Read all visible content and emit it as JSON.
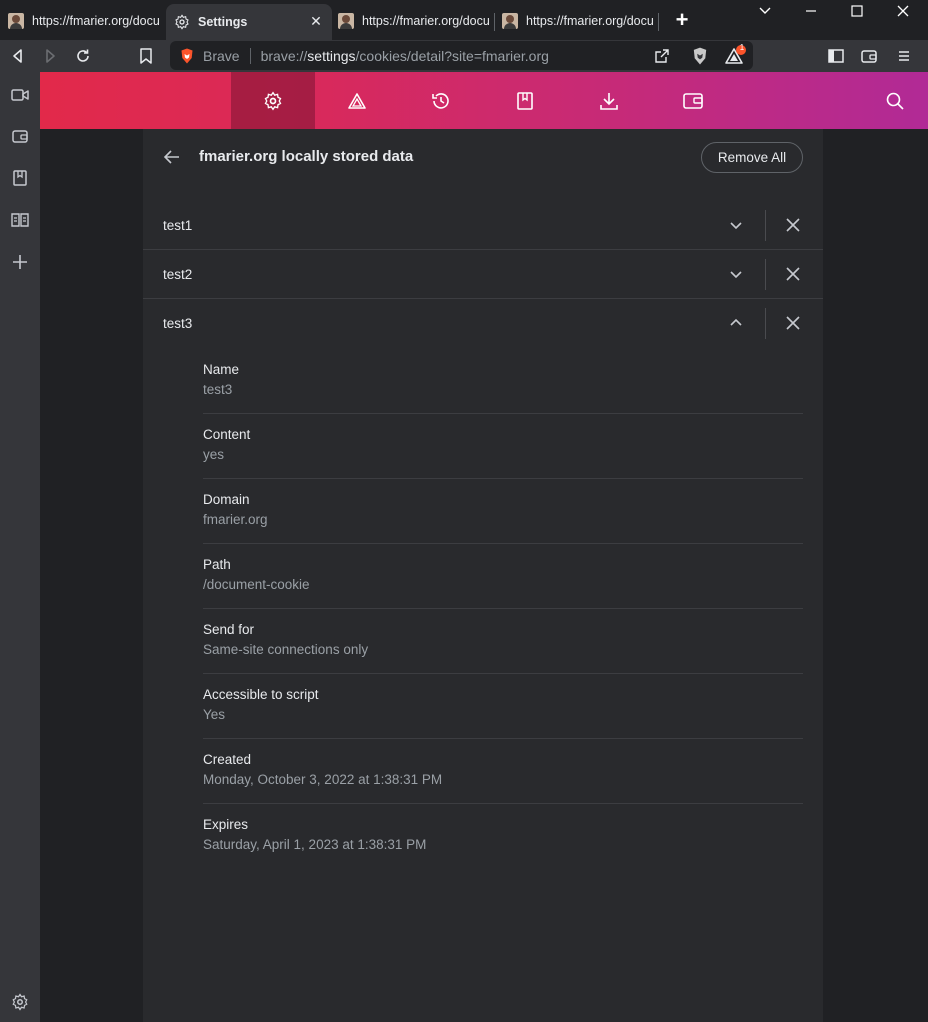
{
  "tabs": [
    {
      "title": "https://fmarier.org/docu",
      "favicon": "person-photo",
      "active": false
    },
    {
      "title": "Settings",
      "favicon": "gear-icon",
      "active": true
    },
    {
      "title": "https://fmarier.org/docu",
      "favicon": "person-photo",
      "active": false
    },
    {
      "title": "https://fmarier.org/docu",
      "favicon": "person-photo",
      "active": false
    }
  ],
  "toolbar": {
    "brand_label": "Brave",
    "url_scheme": "brave://",
    "url_host": "settings",
    "url_path": "/cookies/detail?site=fmarier.org",
    "rewards_badge": "1"
  },
  "header_nav": [
    "gear-icon",
    "brave-rewards-icon",
    "history-icon",
    "bookmarks-icon",
    "downloads-icon",
    "wallet-icon",
    "search-icon"
  ],
  "page": {
    "title": "fmarier.org locally stored data",
    "remove_all": "Remove All"
  },
  "cookies": [
    {
      "name": "test1",
      "expanded": false
    },
    {
      "name": "test2",
      "expanded": false
    },
    {
      "name": "test3",
      "expanded": true
    }
  ],
  "details": [
    {
      "label": "Name",
      "value": "test3"
    },
    {
      "label": "Content",
      "value": "yes"
    },
    {
      "label": "Domain",
      "value": "fmarier.org"
    },
    {
      "label": "Path",
      "value": "/document-cookie"
    },
    {
      "label": "Send for",
      "value": "Same-site connections only"
    },
    {
      "label": "Accessible to script",
      "value": "Yes"
    },
    {
      "label": "Created",
      "value": "Monday, October 3, 2022 at 1:38:31 PM"
    },
    {
      "label": "Expires",
      "value": "Saturday, April 1, 2023 at 1:38:31 PM"
    }
  ],
  "colors": {
    "header_gradient_start": "#e2294a",
    "header_gradient_end": "#b12a96",
    "card_bg": "#292a2d",
    "page_bg": "#202124"
  }
}
